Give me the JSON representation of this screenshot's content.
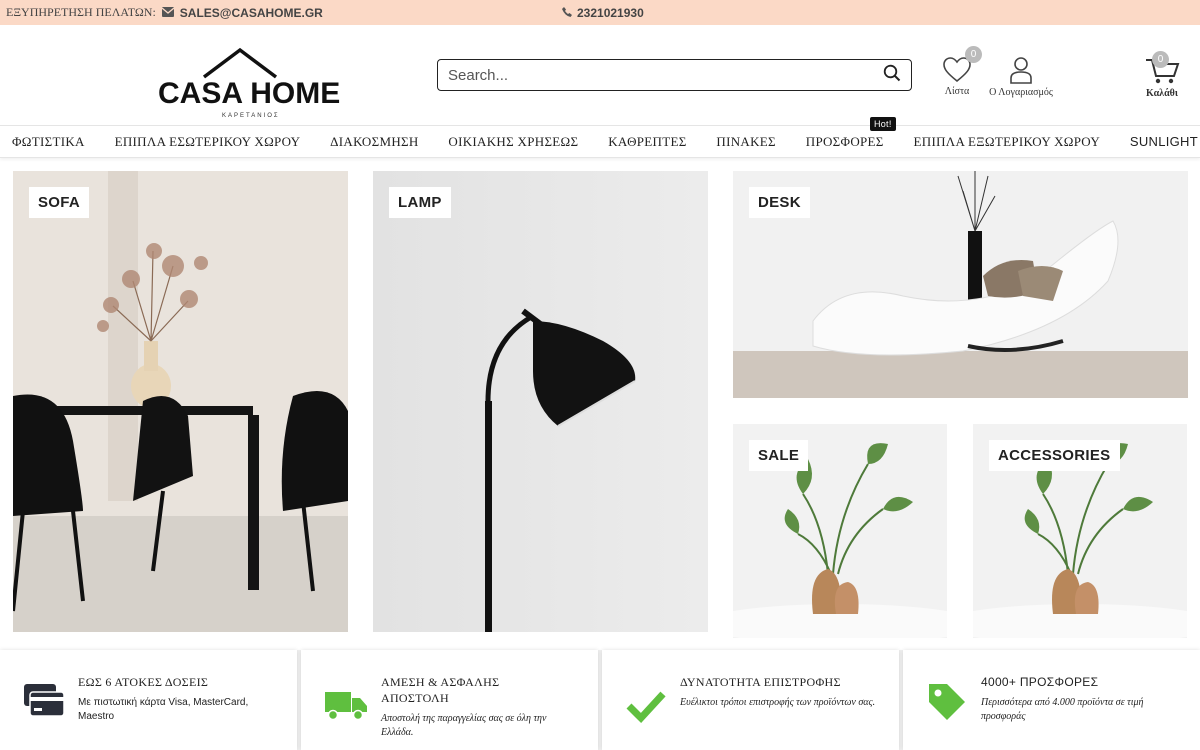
{
  "topbar": {
    "service_label": "ΕΞΥΠΗΡΕΤΗΣΗ ΠΕΛΑΤΩΝ:",
    "email": "SALES@CASAHOME.GR",
    "phone": "2321021930"
  },
  "logo": {
    "brand": "CASA HOME",
    "sub": "ΚΑΡΕΤΑΝΙΟΣ"
  },
  "search": {
    "placeholder": "Search..."
  },
  "header_icons": {
    "wishlist_label": "Λίστα",
    "wishlist_count": "0",
    "account_label": "Ο Λογαριασμός",
    "cart_label": "Καλάθι",
    "cart_count": "0"
  },
  "nav": [
    {
      "label": "ΦΩΤΙΣΤΙΚΑ"
    },
    {
      "label": "ΕΠΙΠΛΑ ΕΣΩΤΕΡΙΚΟΥ ΧΩΡΟΥ"
    },
    {
      "label": "ΔΙΑΚΟΣΜΗΣΗ"
    },
    {
      "label": "ΟΙΚΙΑΚΗΣ ΧΡΗΣΕΩΣ"
    },
    {
      "label": "ΚΑΘΡΕΠΤΕΣ"
    },
    {
      "label": "ΠΙΝΑΚΕΣ"
    },
    {
      "label": "ΠΡΟΣΦΟΡΕΣ",
      "badge": "Hot!"
    },
    {
      "label": "ΕΠΙΠΛΑ ΕΞΩΤΕΡΙΚΟΥ ΧΩΡΟΥ"
    },
    {
      "label": "SUNLIGHT"
    }
  ],
  "tiles": {
    "sofa": "SOFA",
    "lamp": "LAMP",
    "desk": "DESK",
    "sale": "SALE",
    "accessories": "ACCESSORIES"
  },
  "features": [
    {
      "title": "ΕΩΣ 6 ΑΤΟΚΕΣ ΔΟΣΕΙΣ",
      "desc": "Με πιστωτική κάρτα Visa, MasterCard, Maestro",
      "icon": "credit-card-icon",
      "color": "#2b2f3a"
    },
    {
      "title": "ΑΜΕΣΗ & ΑΣΦΑΛΗΣ ΑΠΟΣΤΟΛΗ",
      "desc": "Αποστολή της παραγγελίας σας σε όλη την Ελλάδα.",
      "icon": "truck-icon",
      "color": "#5fbf3f"
    },
    {
      "title": "ΔΥΝΑΤΟΤΗΤΑ ΕΠΙΣΤΡΟΦΗΣ",
      "desc": "Ευέλικτοι τρόποι επιστροφής των προϊόντων σας.",
      "icon": "checkmark-icon",
      "color": "#5fbf3f"
    },
    {
      "title": "4000+ ΠΡΟΣΦΟΡΕΣ",
      "desc": "Περισσότερα από 4.000 προϊόντα σε τιμή προσφοράς",
      "icon": "tag-icon",
      "color": "#5fbf3f"
    }
  ]
}
